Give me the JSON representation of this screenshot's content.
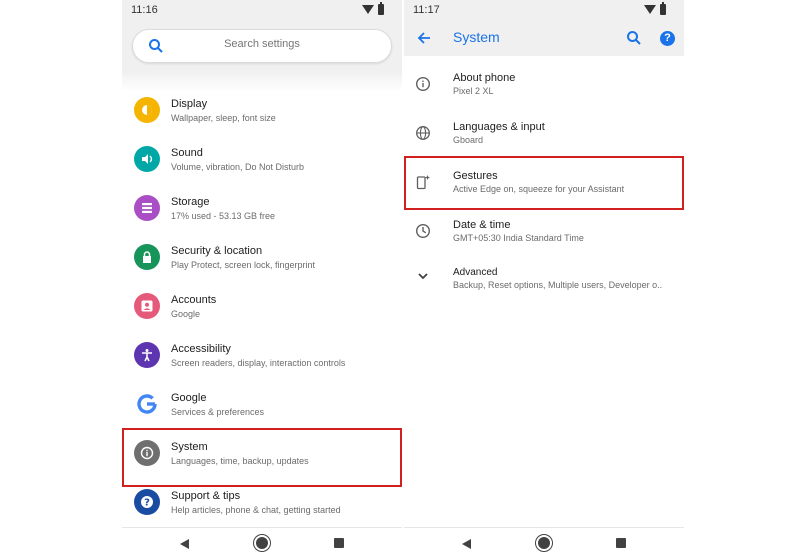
{
  "left": {
    "status_time": "11:16",
    "search_placeholder": "Search settings",
    "items": [
      {
        "title": "Display",
        "subtitle": "Wallpaper, sleep, font size",
        "icon": "display-icon",
        "color": "#f4b400"
      },
      {
        "title": "Sound",
        "subtitle": "Volume, vibration, Do Not Disturb",
        "icon": "sound-icon",
        "color": "#00a7a7"
      },
      {
        "title": "Storage",
        "subtitle": "17% used - 53.13 GB free",
        "icon": "storage-icon",
        "color": "#a94ec4"
      },
      {
        "title": "Security & location",
        "subtitle": "Play Protect, screen lock, fingerprint",
        "icon": "lock-icon",
        "color": "#17945a"
      },
      {
        "title": "Accounts",
        "subtitle": "Google",
        "icon": "account-icon",
        "color": "#e5597a"
      },
      {
        "title": "Accessibility",
        "subtitle": "Screen readers, display, interaction controls",
        "icon": "accessibility-icon",
        "color": "#5e35b1"
      },
      {
        "title": "Google",
        "subtitle": "Services & preferences",
        "icon": "google-icon",
        "color": "#ffffff"
      },
      {
        "title": "System",
        "subtitle": "Languages, time, backup, updates",
        "icon": "info-icon",
        "color": "#6f6f6f"
      },
      {
        "title": "Support & tips",
        "subtitle": "Help articles, phone & chat, getting started",
        "icon": "help-icon",
        "color": "#1a4da1"
      }
    ]
  },
  "right": {
    "status_time": "11:17",
    "title": "System",
    "items": [
      {
        "title": "About phone",
        "subtitle": "Pixel 2 XL",
        "icon": "info-outline-icon"
      },
      {
        "title": "Languages & input",
        "subtitle": "Gboard",
        "icon": "globe-icon"
      },
      {
        "title": "Gestures",
        "subtitle": "Active Edge on, squeeze for your Assistant",
        "icon": "gesture-phone-icon"
      },
      {
        "title": "Date & time",
        "subtitle": "GMT+05:30 India Standard Time",
        "icon": "clock-icon"
      },
      {
        "title": "Advanced",
        "subtitle": "Backup, Reset options, Multiple users, Developer o..",
        "icon": "chevron-down-icon"
      }
    ]
  },
  "colors": {
    "accent": "#1a73e8",
    "highlight": "#d21f1f",
    "bar": "#f0f0f0"
  }
}
